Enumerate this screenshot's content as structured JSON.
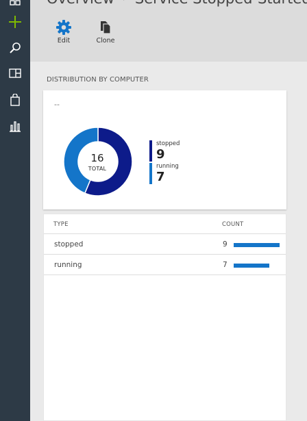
{
  "header": {
    "title_part1": "Overview",
    "separator": "›",
    "title_part2": "Service Stopped-Started"
  },
  "toolbar": {
    "edit_label": "Edit",
    "clone_label": "Clone"
  },
  "sidebar": {
    "icons": [
      "grid-icon",
      "add-icon",
      "search-icon",
      "panel-icon",
      "bag-icon",
      "chart-icon"
    ]
  },
  "section": {
    "title": "DISTRIBUTION BY COMPUTER",
    "placeholder": "--"
  },
  "summary": {
    "total": "16",
    "total_label": "TOTAL"
  },
  "legend": [
    {
      "label": "stopped",
      "value": "9",
      "color": "#0d1b8a"
    },
    {
      "label": "running",
      "value": "7",
      "color": "#1475c9"
    }
  ],
  "table": {
    "col_type": "TYPE",
    "col_count": "COUNT",
    "rows": [
      {
        "type": "stopped",
        "count": "9",
        "fraction": 1.0
      },
      {
        "type": "running",
        "count": "7",
        "fraction": 0.778
      }
    ]
  },
  "chart_data": {
    "type": "pie",
    "categories": [
      "stopped",
      "running"
    ],
    "values": [
      9,
      7
    ],
    "colors": [
      "#0d1b8a",
      "#1475c9"
    ],
    "title": "",
    "center_text": "16 TOTAL"
  },
  "colors": {
    "rail": "#2d3a46",
    "accent_blue": "#1475c9",
    "navy": "#0d1b8a",
    "add_green": "#7fba00"
  }
}
